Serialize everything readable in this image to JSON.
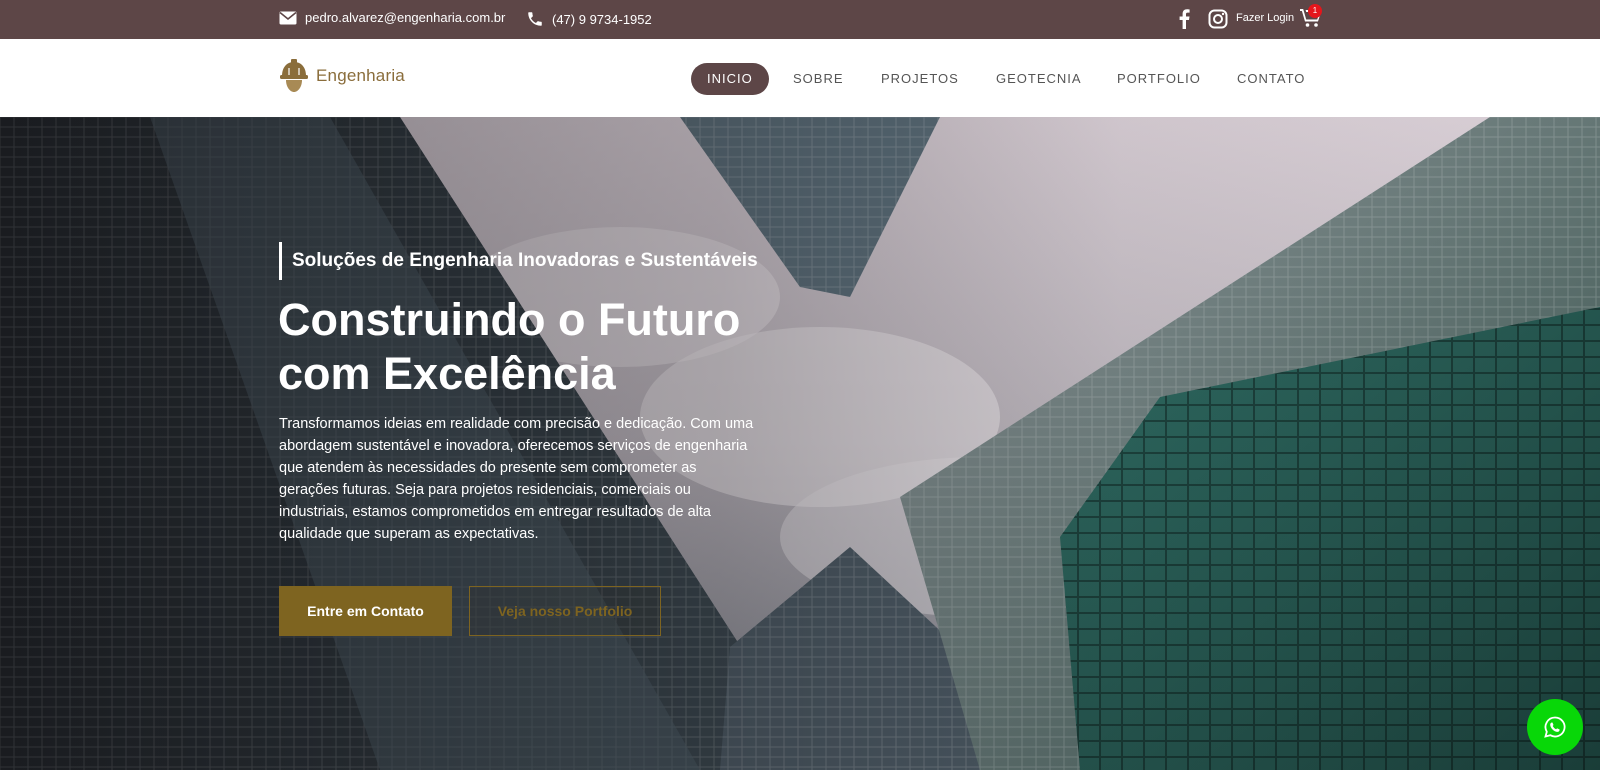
{
  "topbar": {
    "email": "pedro.alvarez@engenharia.com.br",
    "phone": "(47) 9 9734-1952",
    "login_label": "Fazer Login",
    "cart_count": "1",
    "icons": [
      "mail-icon",
      "phone-icon",
      "facebook-icon",
      "instagram-icon",
      "cart-icon"
    ]
  },
  "header": {
    "logo_text": "Engenharia",
    "nav": [
      {
        "label": "INICIO",
        "active": true
      },
      {
        "label": "SOBRE"
      },
      {
        "label": "PROJETOS"
      },
      {
        "label": "GEOTECNIA"
      },
      {
        "label": "PORTFOLIO"
      },
      {
        "label": "CONTATO"
      }
    ]
  },
  "hero": {
    "subtitle": "Soluções de Engenharia Inovadoras e Sustentáveis",
    "headline_line1": "Construindo o Futuro",
    "headline_line2": "com Excelência",
    "body": "Transformamos ideias em realidade com precisão e dedicação. Com uma abordagem sustentável e inovadora, oferecemos serviços de engenharia que atendem às necessidades do presente sem comprometer as gerações futuras. Seja para projetos residenciais, comerciais ou industriais, estamos comprometidos em entregar resultados de alta qualidade que superam as expectativas.",
    "primary_button": "Entre em Contato",
    "secondary_button": "Veja nosso Portfolio"
  },
  "colors": {
    "brand_dark": "#5d4647",
    "accent_gold": "#7e6420",
    "logo_gold": "#8a6d3b",
    "whatsapp_green": "#08d708"
  }
}
